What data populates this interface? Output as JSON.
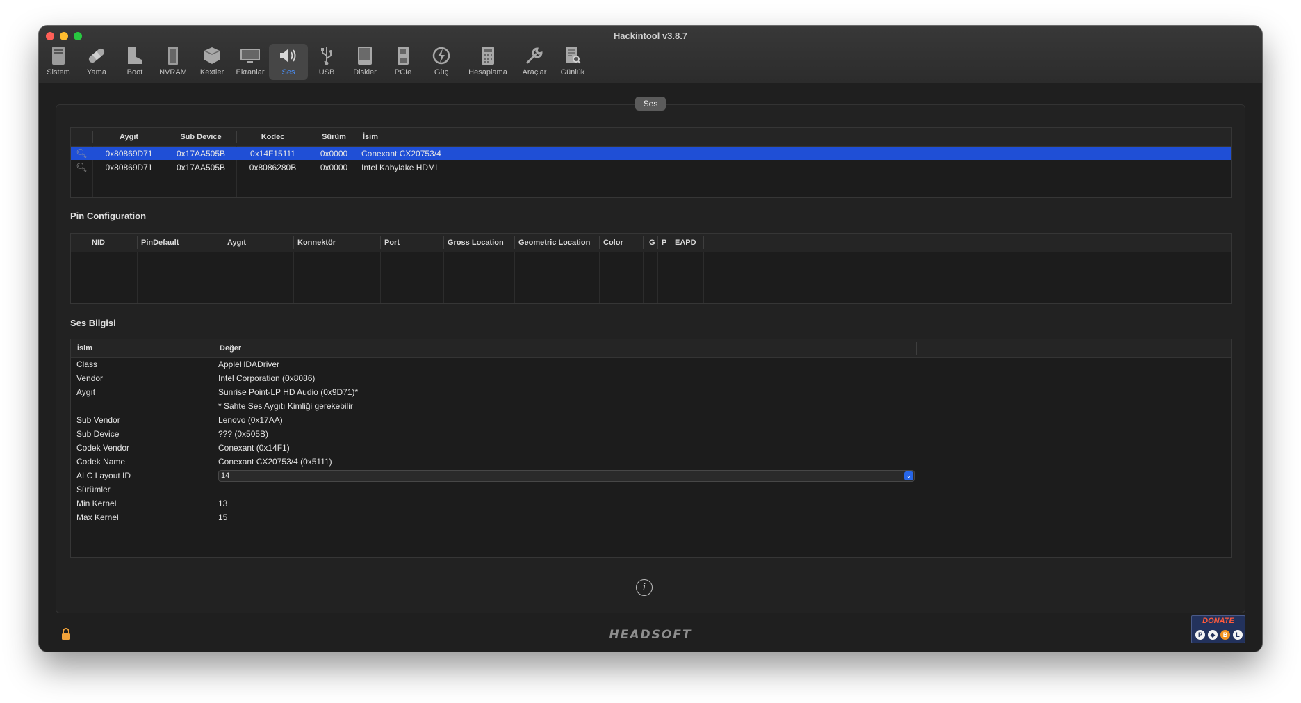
{
  "window": {
    "title": "Hackintool v3.8.7"
  },
  "toolbar": [
    {
      "label": "Sistem",
      "icon": "computer-icon"
    },
    {
      "label": "Yama",
      "icon": "bandage-icon"
    },
    {
      "label": "Boot",
      "icon": "boot-icon"
    },
    {
      "label": "NVRAM",
      "icon": "chip-icon"
    },
    {
      "label": "Kextler",
      "icon": "box-icon"
    },
    {
      "label": "Ekranlar",
      "icon": "display-icon"
    },
    {
      "label": "Ses",
      "icon": "speaker-icon",
      "active": true
    },
    {
      "label": "USB",
      "icon": "usb-icon"
    },
    {
      "label": "Diskler",
      "icon": "disk-icon"
    },
    {
      "label": "PCIe",
      "icon": "pcie-card-icon"
    },
    {
      "label": "Güç",
      "icon": "power-icon"
    },
    {
      "label": "Hesaplama",
      "icon": "calculator-icon"
    },
    {
      "label": "Araçlar",
      "icon": "wrench-icon"
    },
    {
      "label": "Günlük",
      "icon": "log-icon"
    }
  ],
  "group_label": "Ses",
  "devices": {
    "columns": [
      "Aygıt",
      "Sub Device",
      "Kodec",
      "Sürüm",
      "İsim"
    ],
    "rows": [
      {
        "device": "0x80869D71",
        "sub_device": "0x17AA505B",
        "codec": "0x14F15111",
        "revision": "0x0000",
        "name": "Conexant CX20753/4",
        "selected": true
      },
      {
        "device": "0x80869D71",
        "sub_device": "0x17AA505B",
        "codec": "0x8086280B",
        "revision": "0x0000",
        "name": "Intel Kabylake HDMI",
        "selected": false
      }
    ]
  },
  "pin_config": {
    "title": "Pin Configuration",
    "columns": [
      "NID",
      "PinDefault",
      "Aygıt",
      "Konnektör",
      "Port",
      "Gross Location",
      "Geometric Location",
      "Color",
      "G",
      "P",
      "EAPD"
    ]
  },
  "audio_info": {
    "title": "Ses Bilgisi",
    "columns": [
      "İsim",
      "Değer"
    ],
    "rows": [
      {
        "name": "Class",
        "value": "AppleHDADriver"
      },
      {
        "name": "Vendor",
        "value": "Intel Corporation (0x8086)"
      },
      {
        "name": "Aygıt",
        "value": "Sunrise Point-LP HD Audio (0x9D71)*"
      },
      {
        "name": "",
        "value": "* Sahte Ses Aygıtı Kimliği gerekebilir"
      },
      {
        "name": "Sub Vendor",
        "value": "Lenovo (0x17AA)"
      },
      {
        "name": "Sub Device",
        "value": "??? (0x505B)"
      },
      {
        "name": "Codek Vendor",
        "value": "Conexant (0x14F1)"
      },
      {
        "name": "Codek Name",
        "value": "Conexant CX20753/4 (0x5111)"
      },
      {
        "name": "ALC Layout ID",
        "value": "14",
        "control": "select"
      },
      {
        "name": "Sürümler",
        "value": ""
      },
      {
        "name": "Min Kernel",
        "value": "13"
      },
      {
        "name": "Max Kernel",
        "value": "15"
      }
    ]
  },
  "footer": {
    "brand": "HEADSOFT",
    "donate_label": "DONATE",
    "donate_coins": [
      "paypal-icon",
      "ethereum-icon",
      "bitcoin-icon",
      "litecoin-icon"
    ]
  }
}
